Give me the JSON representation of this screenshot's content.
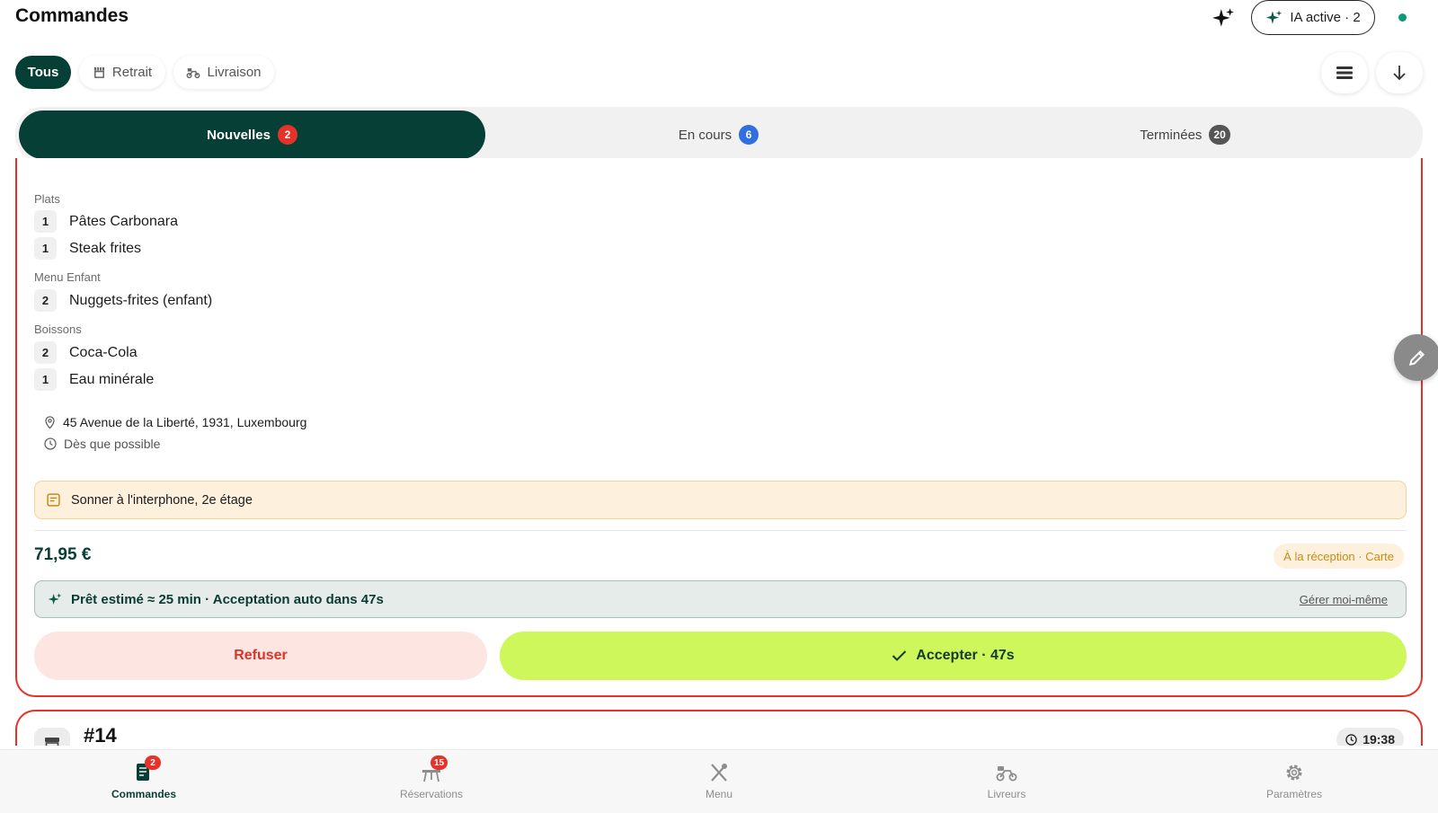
{
  "header": {
    "title": "Commandes",
    "ai_pill_label": "IA active · 2"
  },
  "filters": [
    {
      "label": "Tous",
      "icon": "none",
      "active": true
    },
    {
      "label": "Retrait",
      "icon": "store-icon",
      "active": false
    },
    {
      "label": "Livraison",
      "icon": "scooter-icon",
      "active": false
    }
  ],
  "segments": [
    {
      "label": "Nouvelles",
      "count": "2",
      "badge_color": "#e5332a",
      "active": true
    },
    {
      "label": "En cours",
      "count": "6",
      "badge_color": "#2f6fe0",
      "active": false
    },
    {
      "label": "Terminées",
      "count": "20",
      "badge_color": "#555555",
      "active": false
    }
  ],
  "order": {
    "sections": [
      {
        "label": "Plats",
        "items": [
          {
            "qty": "1",
            "name": "Pâtes Carbonara"
          },
          {
            "qty": "1",
            "name": "Steak frites"
          }
        ]
      },
      {
        "label": "Menu Enfant",
        "items": [
          {
            "qty": "2",
            "name": "Nuggets-frites (enfant)"
          }
        ]
      },
      {
        "label": "Boissons",
        "items": [
          {
            "qty": "2",
            "name": "Coca-Cola"
          },
          {
            "qty": "1",
            "name": "Eau minérale"
          }
        ]
      }
    ],
    "address": "45 Avenue de la Liberté, 1931, Luxembourg",
    "timing": "Dès que possible",
    "note": "Sonner à l'interphone, 2e étage",
    "total": "71,95 €",
    "payment": "À la réception · Carte",
    "ai_estimate": "Prêt estimé ≈ 25 min · Acceptation auto dans 47s",
    "manage_label": "Gérer moi-même",
    "refuse_label": "Refuser",
    "accept_label": "Accepter · 47s"
  },
  "next_order": {
    "number": "#14",
    "time": "19:38"
  },
  "bottom_nav": [
    {
      "label": "Commandes",
      "badge": "2",
      "icon": "receipt-icon",
      "active": true
    },
    {
      "label": "Réservations",
      "badge": "15",
      "icon": "table-icon",
      "active": false
    },
    {
      "label": "Menu",
      "badge": "",
      "icon": "utensils-icon",
      "active": false
    },
    {
      "label": "Livreurs",
      "badge": "",
      "icon": "scooter-icon",
      "active": false
    },
    {
      "label": "Paramètres",
      "badge": "",
      "icon": "gear-icon",
      "active": false
    }
  ],
  "colors": {
    "primary": "#063f35",
    "accent_lime": "#cdf75a",
    "alert_red": "#e5332a",
    "note_bg": "#fdf1dd"
  }
}
